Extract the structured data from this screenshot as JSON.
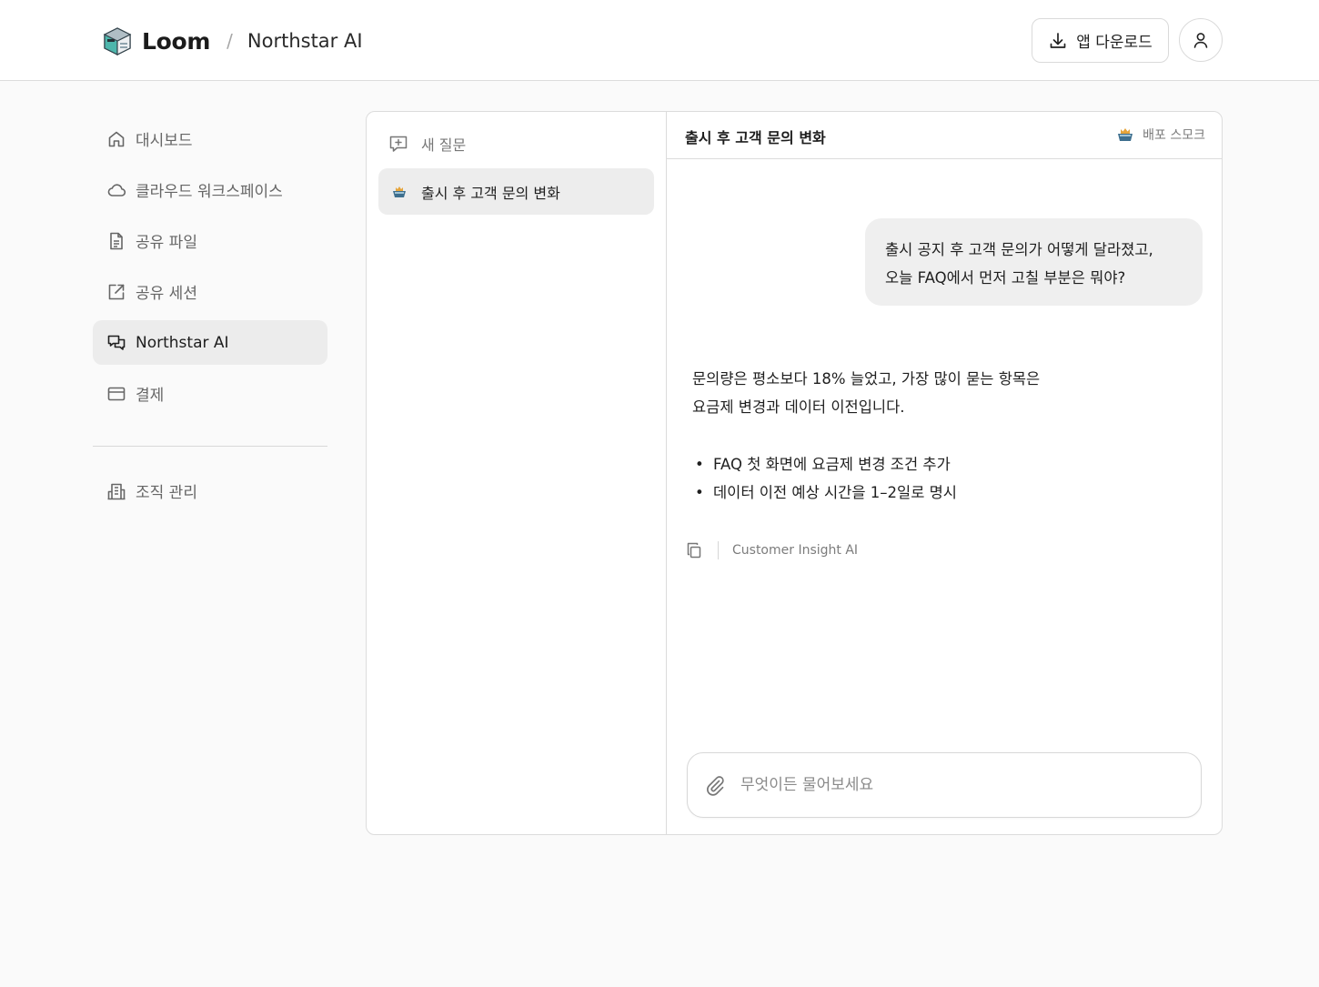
{
  "header": {
    "brand": "Loom",
    "separator": "/",
    "page": "Northstar AI",
    "download_label": "앱 다운로드",
    "profile_icon": "user-icon"
  },
  "sidebar": {
    "items": [
      {
        "label": "대시보드",
        "icon": "home-icon"
      },
      {
        "label": "클라우드 워크스페이스",
        "icon": "cloud-icon"
      },
      {
        "label": "공유 파일",
        "icon": "file-icon"
      },
      {
        "label": "공유 세션",
        "icon": "share-icon"
      },
      {
        "label": "Northstar AI",
        "icon": "chat-icon",
        "active": true
      },
      {
        "label": "결제",
        "icon": "card-icon"
      }
    ],
    "bottom_items": [
      {
        "label": "조직 관리",
        "icon": "building-icon"
      }
    ]
  },
  "history": {
    "new_question_label": "새 질문",
    "items": [
      {
        "label": "출시 후 고객 문의 변화",
        "active": true
      }
    ]
  },
  "chat": {
    "title": "출시 후 고객 문의 변화",
    "tag": "배포 스모크",
    "user_message": [
      "출시 공지 후 고객 문의가 어떻게 달라졌고,",
      "오늘 FAQ에서 먼저 고칠 부분은 뭐야?"
    ],
    "answer_paragraph": [
      "문의량은 평소보다 18% 늘었고, 가장 많이 묻는 항목은",
      "요금제 변경과 데이터 이전입니다."
    ],
    "answer_bullets": [
      "FAQ 첫 화면에 요금제 변경 조건 추가",
      "데이터 이전 예상 시간을 1–2일로 명시"
    ],
    "answer_source": "Customer Insight AI",
    "composer_placeholder": "무엇이든 물어보세요"
  },
  "colors": {
    "page_bg": "#fafafa",
    "active_bg": "#ececec",
    "bubble_bg": "#efefef",
    "border": "#dcdcdc",
    "text": "#1f1f1f",
    "muted_text": "#777777"
  }
}
